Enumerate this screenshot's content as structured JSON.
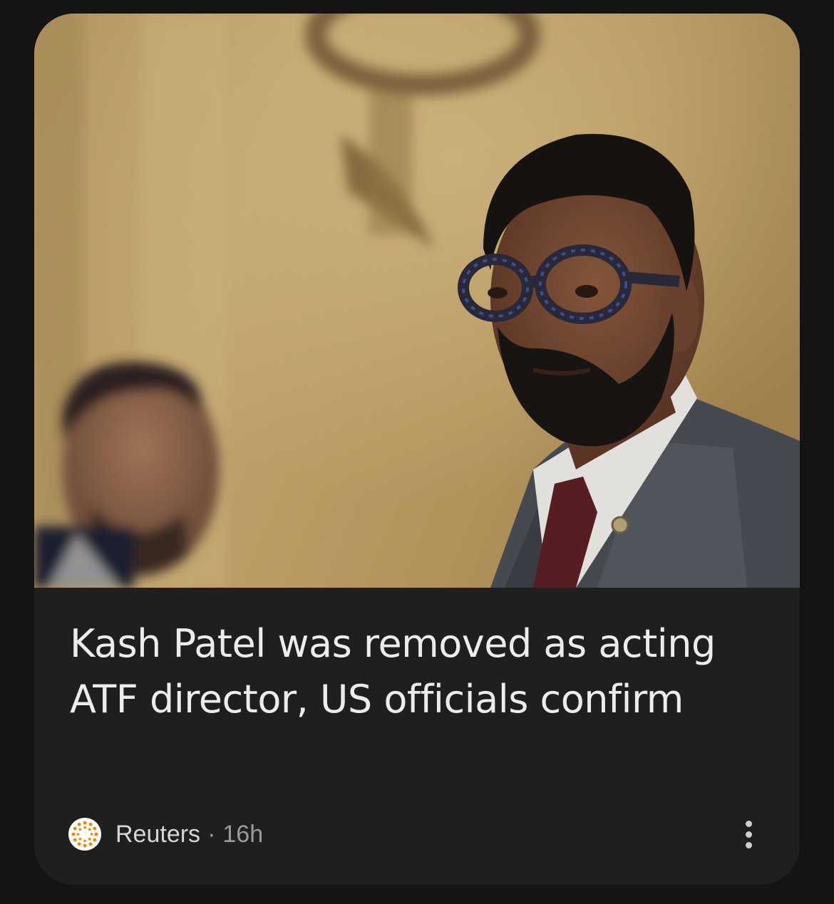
{
  "article": {
    "headline": "Kash Patel was removed as acting ATF director, US officials confirm",
    "source": "Reuters",
    "separator": "·",
    "age": "16h",
    "source_logo_icon": "reuters-logo-icon",
    "more_icon": "more-vertical-icon"
  },
  "colors": {
    "background": "#141414",
    "card": "#1f1f1f",
    "headline": "#ececec",
    "source_text": "#d6d6d6",
    "muted_text": "#9a9a9a",
    "reuters_orange": "#ff8000"
  }
}
